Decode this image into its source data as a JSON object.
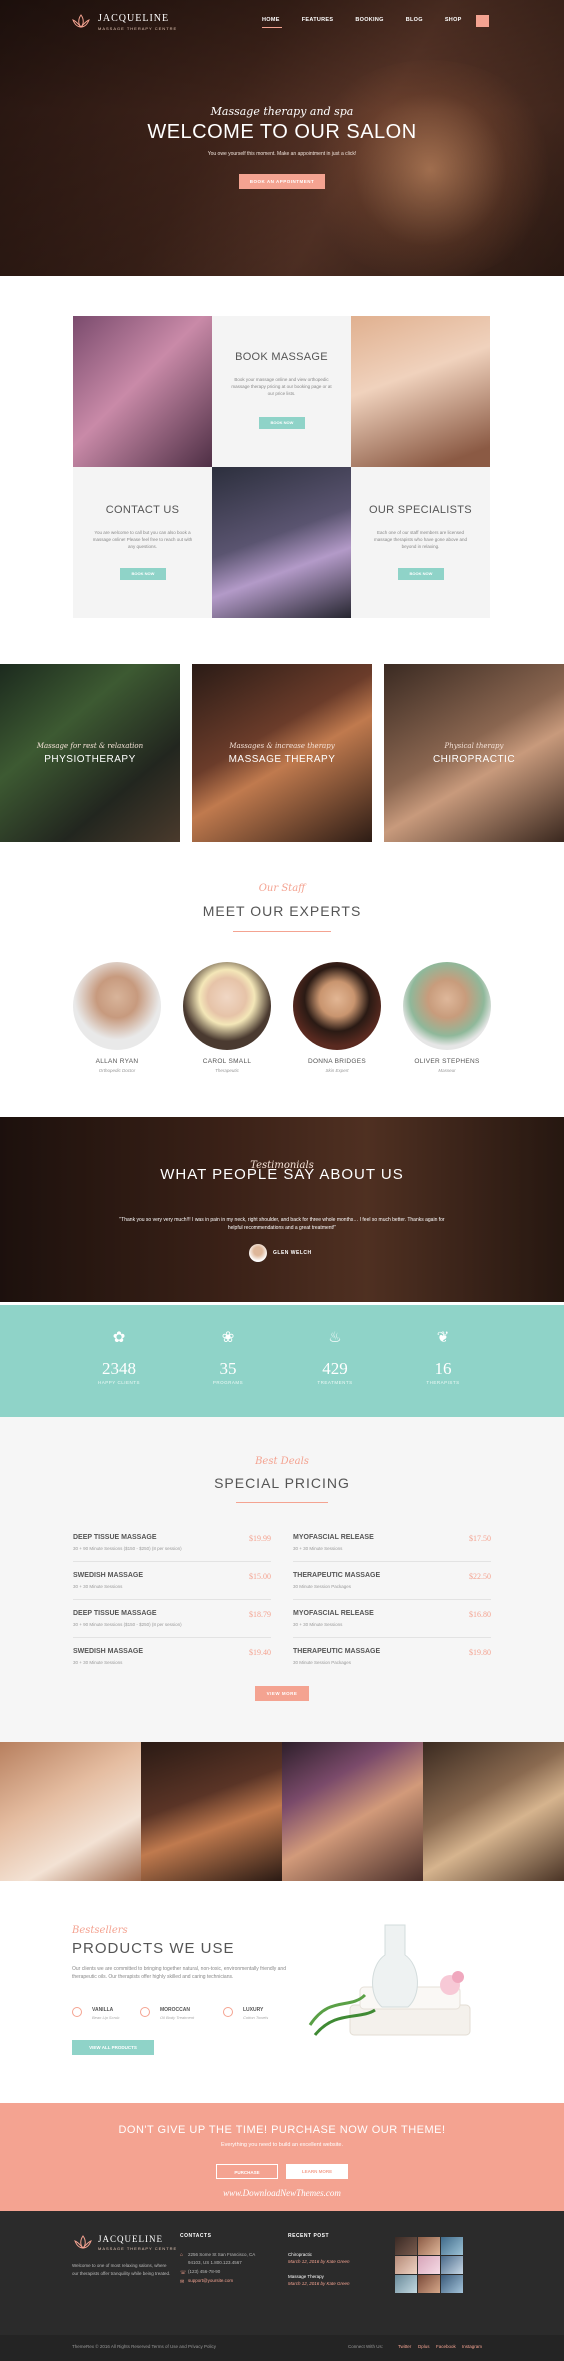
{
  "header": {
    "logo_name": "JACQUELINE",
    "logo_sub": "MASSAGE THERAPY CENTRE",
    "nav": [
      "HOME",
      "FEATURES",
      "BOOKING",
      "BLOG",
      "SHOP"
    ]
  },
  "hero": {
    "subtitle": "Massage therapy and spa",
    "title": "WELCOME TO OUR SALON",
    "text": "You owe yourself this moment. Make an appointment in just a click!",
    "button": "BOOK AN APPOINTMENT"
  },
  "features": {
    "book": {
      "title": "BOOK MASSAGE",
      "text": "Book your massage online and view orthopedic massage therapy pricing at our booking page or at our price lists.",
      "button": "BOOK NOW"
    },
    "contact": {
      "title": "CONTACT US",
      "text": "You are welcome to call but you can also book a massage online! Please feel free to reach out with any questions.",
      "button": "BOOK NOW"
    },
    "specialists": {
      "title": "OUR SPECIALISTS",
      "text": "Each one of our staff members are licensed massage therapists who have gone above and beyond in relaxing.",
      "button": "BOOK NOW"
    }
  },
  "services": [
    {
      "script": "Massage for rest & relaxation",
      "title": "PHYSIOTHERAPY"
    },
    {
      "script": "Massages & increase therapy",
      "title": "MASSAGE THERAPY"
    },
    {
      "script": "Physical therapy",
      "title": "CHIROPRACTIC"
    }
  ],
  "experts": {
    "script": "Our Staff",
    "title": "MEET OUR EXPERTS",
    "people": [
      {
        "name": "ALLAN RYAN",
        "role": "Orthopedic Doctor"
      },
      {
        "name": "CAROL SMALL",
        "role": "Therapeutic"
      },
      {
        "name": "DONNA BRIDGES",
        "role": "Skin Expert"
      },
      {
        "name": "OLIVER STEPHENS",
        "role": "Masseur"
      }
    ]
  },
  "testimonials": {
    "script": "Testimonials",
    "title": "WHAT PEOPLE SAY ABOUT US",
    "quote": "\"Thank you so very very much!!! I was in pain in my neck, right shoulder, and back for three whole months… I feel so much better. Thanks again for helpful recommendations and a great treatment!\"",
    "author": "GLEN WELCH"
  },
  "stats": [
    {
      "icon": "lotus-icon",
      "glyph": "✿",
      "value": "2348",
      "label": "HAPPY CLIENTS"
    },
    {
      "icon": "flower-icon",
      "glyph": "❀",
      "value": "35",
      "label": "PROGRAMS"
    },
    {
      "icon": "bottle-icon",
      "glyph": "♨",
      "value": "429",
      "label": "TREATMENTS"
    },
    {
      "icon": "leaf-icon",
      "glyph": "❦",
      "value": "16",
      "label": "THERAPISTS"
    }
  ],
  "pricing": {
    "script": "Best Deals",
    "title": "SPECIAL PRICING",
    "left": [
      {
        "name": "DEEP TISSUE MASSAGE",
        "price": "$19.99",
        "desc": "30 + 90 Minute Sessions ($150 - $250) (8 per session)"
      },
      {
        "name": "SWEDISH MASSAGE",
        "price": "$15.00",
        "desc": "30 + 30 Minute Sessions"
      },
      {
        "name": "DEEP TISSUE MASSAGE",
        "price": "$18.79",
        "desc": "30 + 90 Minute Sessions ($150 - $250) (8 per session)"
      },
      {
        "name": "SWEDISH MASSAGE",
        "price": "$19.40",
        "desc": "30 + 30 Minute Sessions"
      }
    ],
    "right": [
      {
        "name": "MYOFASCIAL RELEASE",
        "price": "$17.50",
        "desc": "30 + 30 Minute Sessions"
      },
      {
        "name": "THERAPEUTIC MASSAGE",
        "price": "$22.50",
        "desc": "30 Minute Session Packages"
      },
      {
        "name": "MYOFASCIAL RELEASE",
        "price": "$16.80",
        "desc": "30 + 30 Minute Sessions"
      },
      {
        "name": "THERAPEUTIC MASSAGE",
        "price": "$19.80",
        "desc": "30 Minute Session Packages"
      }
    ],
    "button": "VIEW MORE"
  },
  "products": {
    "script": "Bestsellers",
    "title": "PRODUCTS WE USE",
    "text": "Our clients we are committed to bringing together natural, non-toxic, environmentally friendly and therapeutic oils. Our therapists offer highly skilled and caring technicians.",
    "items": [
      {
        "name": "VANILLA",
        "sub": "Bean Lip Scrub"
      },
      {
        "name": "MOROCCAN",
        "sub": "Oil Body Treatment"
      },
      {
        "name": "LUXURY",
        "sub": "Cotton Towels"
      }
    ],
    "button": "VIEW ALL PRODUCTS"
  },
  "cta": {
    "title": "DON'T GIVE UP THE TIME! PURCHASE NOW OUR THEME!",
    "subtitle": "Everything you need to build an excellent website.",
    "btn1": "PURCHASE",
    "btn2": "LEARN MORE",
    "watermark": "www.DownloadNewThemes.com"
  },
  "footer": {
    "about": "Welcome to one of most relaxing salons, where our therapists offer tranquility while being treated.",
    "contacts_head": "CONTACTS",
    "address": "2256 Some St San Francisco, CA 94103, US 1.800.123.4567",
    "phone": "(123) 456-78-90",
    "email": "support@yoursite.com",
    "recent_head": "RECENT POST",
    "posts": [
      {
        "title": "Chiropractic",
        "meta": "March 12, 2016 by Kate Green"
      },
      {
        "title": "Massage Therapy",
        "meta": "March 12, 2016 by Kate Green"
      }
    ],
    "copyright": "ThemeRex © 2016 All Rights Reserved Terms of Use and Privacy Policy",
    "social_label": "Connect With Us:",
    "social": [
      "Twitter",
      "Dplus",
      "Facebook",
      "Instagram"
    ]
  },
  "colors": {
    "accent": "#f4a391",
    "teal": "#8fd3c8",
    "dark": "#2b2b2b"
  }
}
